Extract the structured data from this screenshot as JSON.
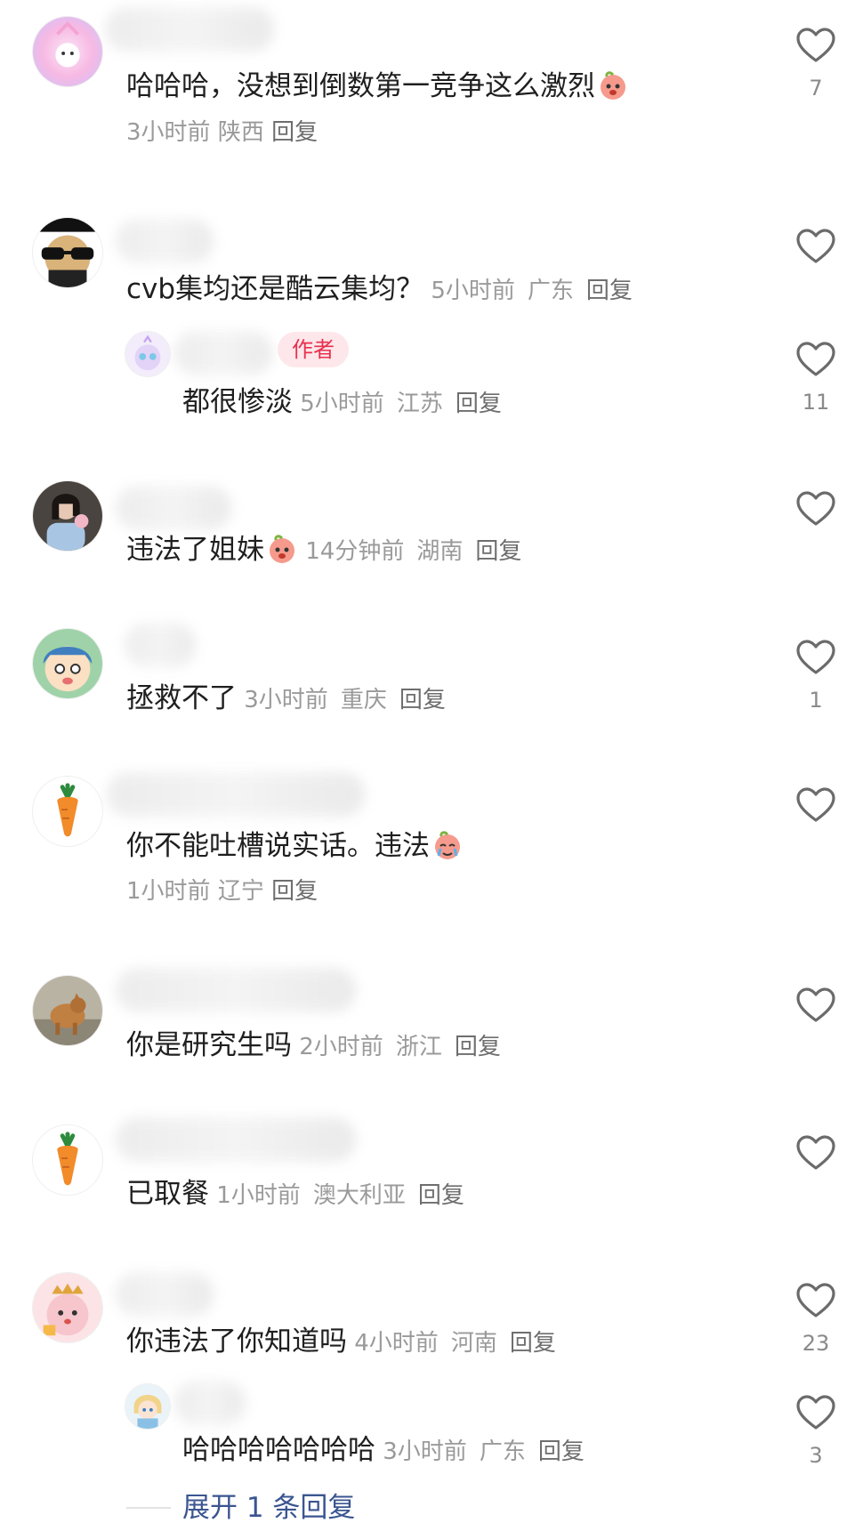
{
  "comments": [
    {
      "text": "哈哈哈，没想到倒数第一竞争这么激烈",
      "time": "3小时前",
      "location": "陕西",
      "reply": "回复",
      "likes": "7"
    },
    {
      "text": "cvb集均还是酷云集均？",
      "time": "5小时前",
      "location": "广东",
      "reply": "回复",
      "likes": ""
    },
    {
      "text": "都很惨淡",
      "time": "5小时前",
      "location": "江苏",
      "reply": "回复",
      "likes": "11",
      "badge": "作者"
    },
    {
      "text": "违法了姐妹",
      "time": "14分钟前",
      "location": "湖南",
      "reply": "回复",
      "likes": ""
    },
    {
      "text": "拯救不了",
      "time": "3小时前",
      "location": "重庆",
      "reply": "回复",
      "likes": "1"
    },
    {
      "text": "你不能吐槽说实话。违法",
      "time": "1小时前",
      "location": "辽宁",
      "reply": "回复",
      "likes": ""
    },
    {
      "text": "你是研究生吗",
      "time": "2小时前",
      "location": "浙江",
      "reply": "回复",
      "likes": ""
    },
    {
      "text": "已取餐",
      "time": "1小时前",
      "location": "澳大利亚",
      "reply": "回复",
      "likes": ""
    },
    {
      "text": "你违法了你知道吗",
      "time": "4小时前",
      "location": "河南",
      "reply": "回复",
      "likes": "23"
    },
    {
      "text": "哈哈哈哈哈哈哈",
      "time": "3小时前",
      "location": "广东",
      "reply": "回复",
      "likes": "3"
    }
  ],
  "expand": {
    "label": "展开 1 条回复"
  },
  "icons": {
    "like": "heart-outline-icon",
    "emoji": "peach-face-emoji"
  },
  "colors": {
    "author_badge_bg": "#fde7ea",
    "author_badge_text": "#e8304f",
    "expand_link": "#3b5590"
  }
}
